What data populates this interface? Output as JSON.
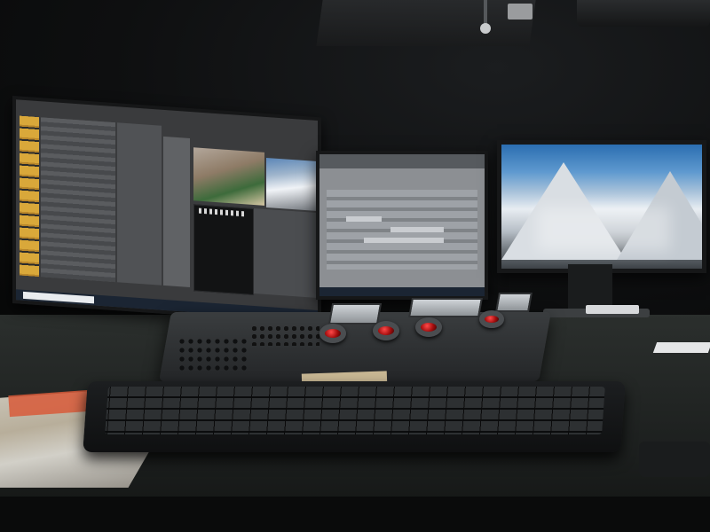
{
  "scene": {
    "description_type": "photo-of-editing-suite",
    "palette": {
      "wall": "#0e0f10",
      "desk": "#2b2f2d",
      "accent_red": "#d0131b",
      "clip_amber": "#d9a83a",
      "sky_blue": "#2b6eb1"
    }
  },
  "devices": {
    "left_monitor": {
      "icon": "monitor-icon"
    },
    "middle_monitor": {
      "icon": "monitor-icon"
    },
    "right_monitor": {
      "icon": "monitor-icon"
    },
    "grading_panel": {
      "icon": "trackball-panel-icon"
    },
    "keyboard": {
      "icon": "keyboard-icon"
    }
  }
}
